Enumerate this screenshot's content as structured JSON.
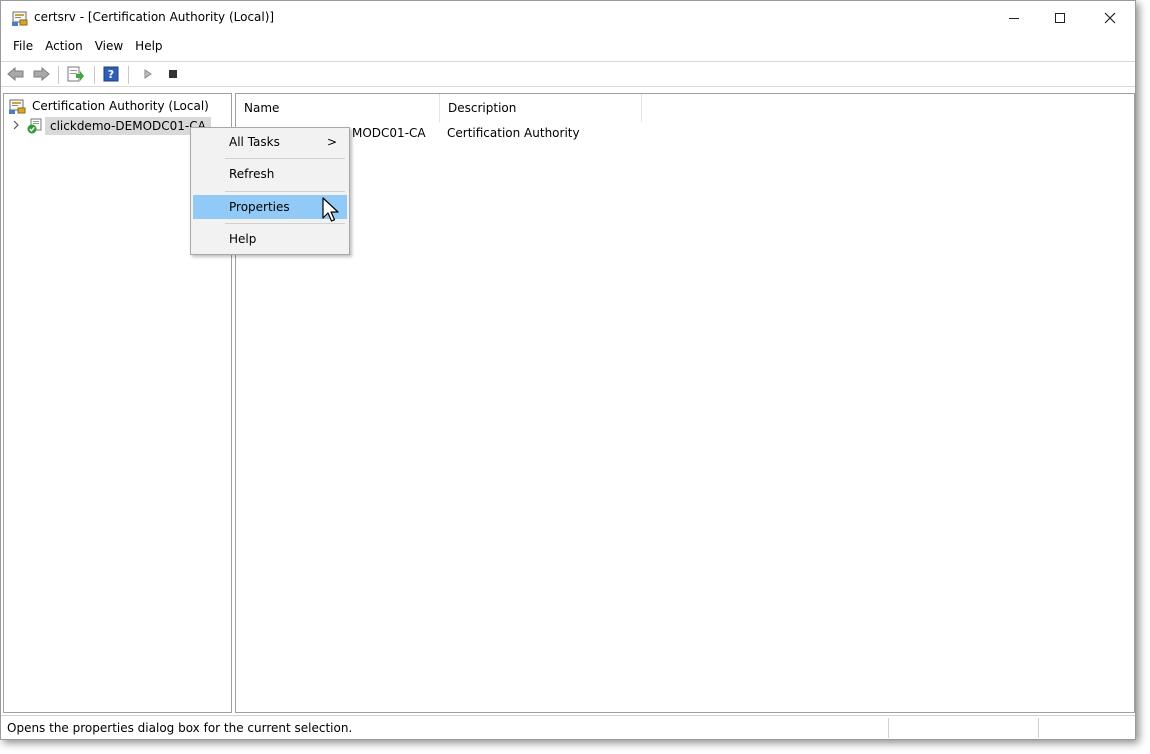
{
  "window": {
    "title": "certsrv - [Certification Authority (Local)]"
  },
  "menubar": [
    "File",
    "Action",
    "View",
    "Help"
  ],
  "tree": {
    "root": "Certification Authority (Local)",
    "child": "clickdemo-DEMODC01-CA"
  },
  "list": {
    "columns": [
      "Name",
      "Description"
    ],
    "rows": [
      {
        "name": "clickdemo-DEMODC01-CA",
        "name_visible": "MODC01-CA",
        "description": "Certification Authority"
      }
    ]
  },
  "context_menu": {
    "items": [
      "All Tasks",
      "Refresh",
      "Properties",
      "Help"
    ],
    "highlighted": "Properties",
    "submenu_arrow": ">"
  },
  "statusbar": {
    "text": "Opens the properties dialog box for the current selection."
  },
  "icons": {
    "window_controls": [
      "minimize-icon",
      "maximize-icon",
      "close-icon"
    ],
    "toolbar": [
      "back-icon",
      "forward-icon",
      "export-list-icon",
      "help-icon",
      "start-service-icon",
      "stop-service-icon"
    ]
  },
  "colors": {
    "highlight": "#91c9f7",
    "menu_bg": "#f2f2f2",
    "cert_green": "#2e9b2e"
  }
}
